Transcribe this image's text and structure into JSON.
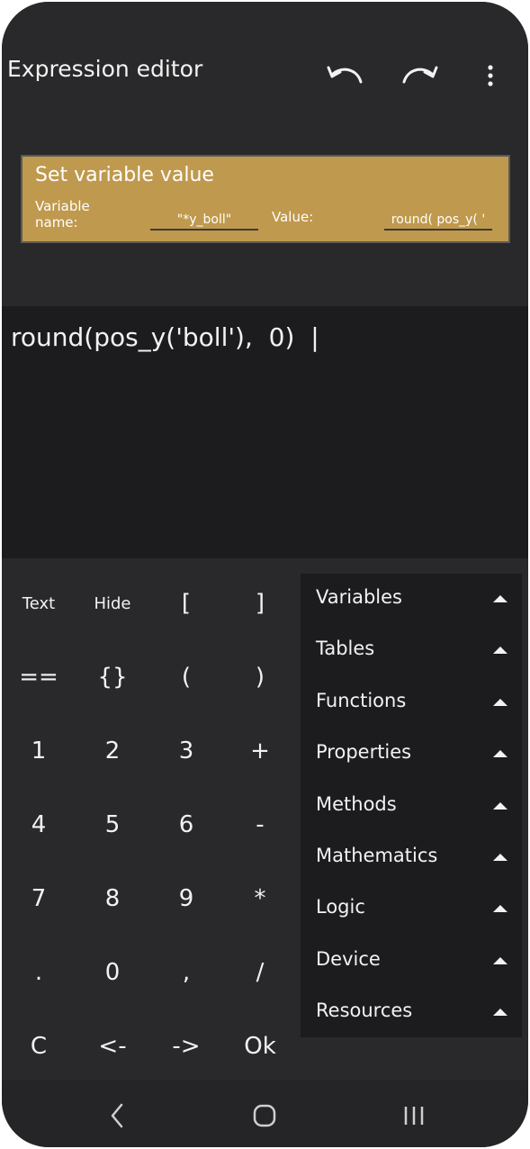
{
  "header": {
    "title": "Expression editor",
    "undo_icon": "undo-icon",
    "redo_icon": "redo-icon",
    "more_icon": "more-vert-icon"
  },
  "block": {
    "title": "Set variable value",
    "variable_label_line1": "Variable",
    "variable_label_line2": "name:",
    "variable_value": "\"*y_boll\"",
    "value_label": "Value:",
    "value_value": "round( pos_y( '"
  },
  "expression": {
    "text": "round(pos_y('boll'),  0)  |"
  },
  "keypad": {
    "rows": [
      [
        "Text",
        "Hide",
        "[",
        "]"
      ],
      [
        "==",
        "{}",
        "(",
        ")"
      ],
      [
        "1",
        "2",
        "3",
        "+"
      ],
      [
        "4",
        "5",
        "6",
        "-"
      ],
      [
        "7",
        "8",
        "9",
        "*"
      ],
      [
        ".",
        "0",
        ",",
        "/"
      ],
      [
        "C",
        "<-",
        "->",
        "Ok"
      ]
    ]
  },
  "categories": [
    "Variables",
    "Tables",
    "Functions",
    "Properties",
    "Methods",
    "Mathematics",
    "Logic",
    "Device",
    "Resources"
  ],
  "navbar": {
    "back_icon": "back-icon",
    "home_icon": "home-icon",
    "recents_icon": "recents-icon"
  },
  "colors": {
    "background": "#252527",
    "block": "#bf994d",
    "expression_bg": "#1c1c1e",
    "text": "#f2f2f2"
  }
}
